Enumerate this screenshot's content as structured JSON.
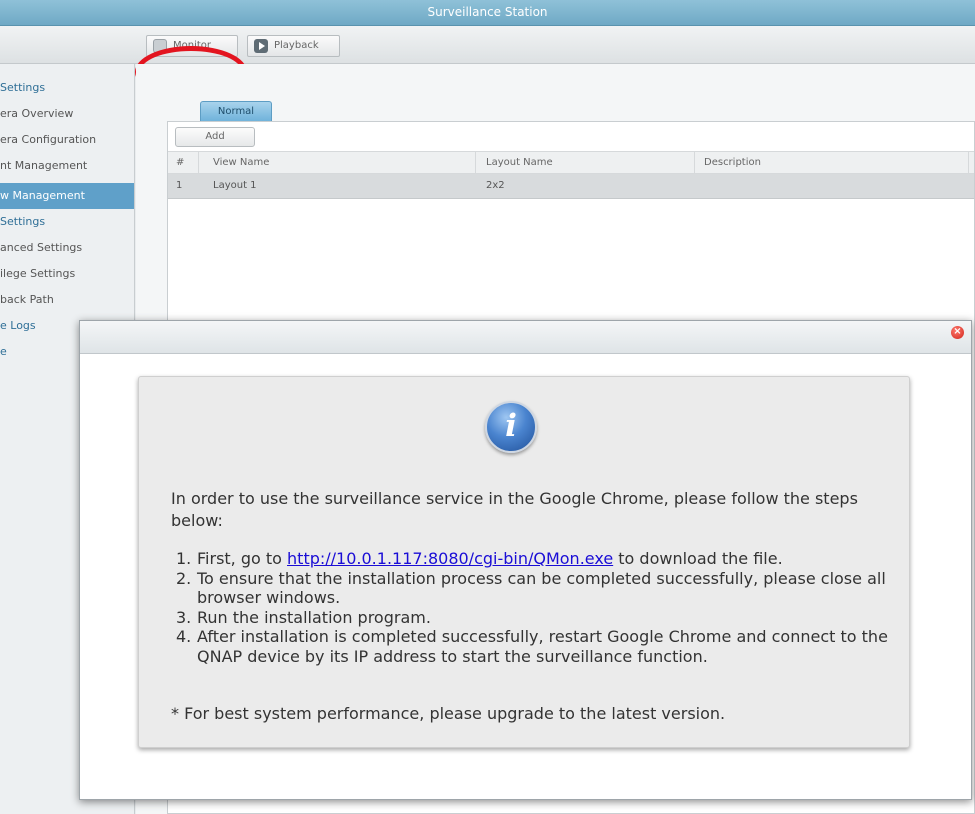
{
  "window": {
    "title": "Surveillance Station"
  },
  "toolbar": {
    "monitor_label": "Monitor",
    "playback_label": "Playback"
  },
  "sidebar": {
    "items": [
      {
        "label": "Settings"
      },
      {
        "label": "era Overview"
      },
      {
        "label": "era Configuration"
      },
      {
        "label": "nt Management"
      },
      {
        "label": "w Management"
      },
      {
        "label": "Settings"
      },
      {
        "label": "anced Settings"
      },
      {
        "label": "ilege Settings"
      },
      {
        "label": "back Path"
      },
      {
        "label": "e Logs"
      },
      {
        "label": "e"
      }
    ]
  },
  "main": {
    "tab_label": "Normal",
    "add_label": "Add",
    "columns": [
      "#",
      "View Name",
      "Layout Name",
      "Description"
    ],
    "rows": [
      {
        "num": "1",
        "view_name": "Layout 1",
        "layout_name": "2x2",
        "description": ""
      }
    ]
  },
  "dialog": {
    "close_glyph": "×",
    "info_glyph": "i",
    "intro": "In order to use the surveillance service in the Google Chrome, please follow the steps below:",
    "step1_num": "1.",
    "step1_pre": "First, go to ",
    "step1_link": "http://10.0.1.117:8080/cgi-bin/QMon.exe",
    "step1_post": " to download the file.",
    "step2_num": "2.",
    "step2": "To ensure that the installation process can be completed successfully, please close all browser windows.",
    "step3_num": "3.",
    "step3": "Run the installation program.",
    "step4_num": "4.",
    "step4": "After installation is completed successfully, restart Google Chrome and connect to the QNAP device by its IP address to start the surveillance function.",
    "note": "* For best system performance, please upgrade to the latest version."
  },
  "colors": {
    "accent": "#5fa0c9",
    "highlight_circle": "#e3141f",
    "link": "#1a0dd6"
  }
}
